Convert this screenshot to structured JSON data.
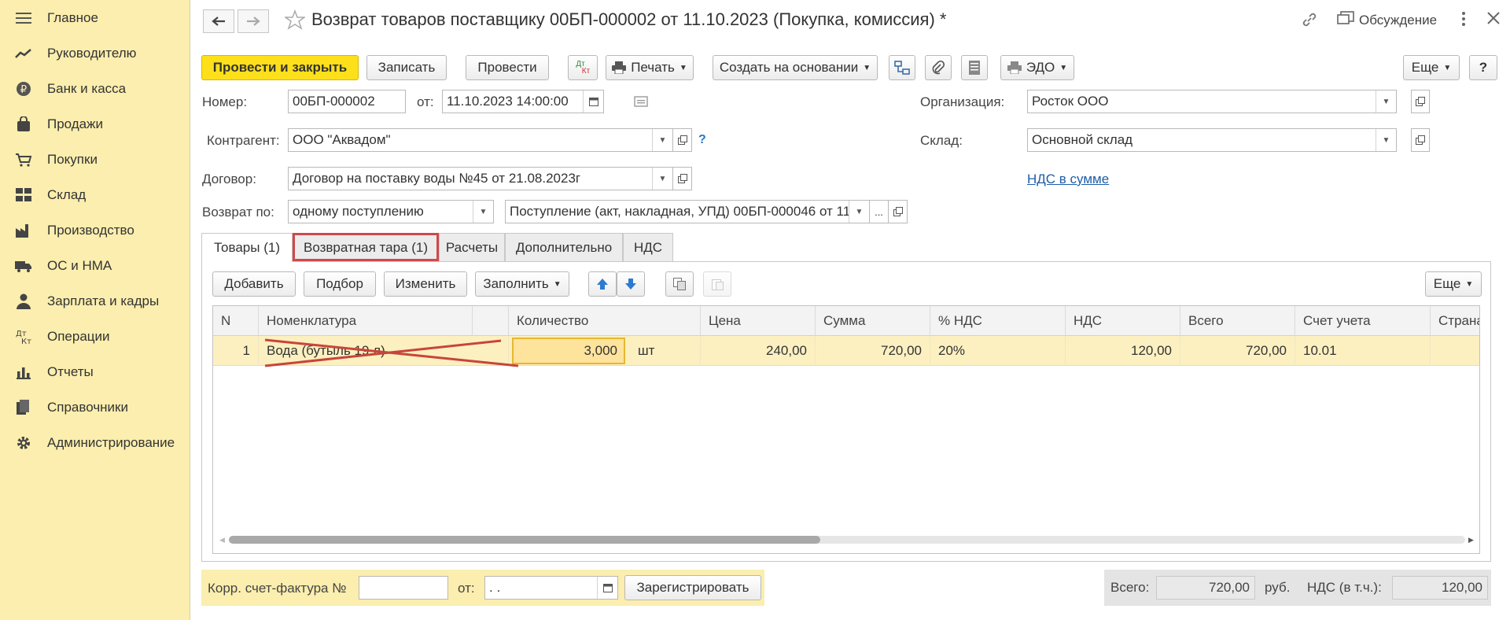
{
  "sidebar": {
    "items": [
      {
        "label": "Главное",
        "icon": "menu-icon"
      },
      {
        "label": "Руководителю",
        "icon": "trend-icon"
      },
      {
        "label": "Банк и касса",
        "icon": "ruble-icon"
      },
      {
        "label": "Продажи",
        "icon": "bag-icon"
      },
      {
        "label": "Покупки",
        "icon": "cart-icon"
      },
      {
        "label": "Склад",
        "icon": "warehouse-icon"
      },
      {
        "label": "Производство",
        "icon": "factory-icon"
      },
      {
        "label": "ОС и НМА",
        "icon": "truck-icon"
      },
      {
        "label": "Зарплата и кадры",
        "icon": "person-icon"
      },
      {
        "label": "Операции",
        "icon": "dt-kt-icon"
      },
      {
        "label": "Отчеты",
        "icon": "bar-chart-icon"
      },
      {
        "label": "Справочники",
        "icon": "books-icon"
      },
      {
        "label": "Администрирование",
        "icon": "gear-icon"
      }
    ]
  },
  "header": {
    "title": "Возврат товаров поставщику 00БП-000002 от 11.10.2023 (Покупка, комиссия) *",
    "discussion_label": "Обсуждение"
  },
  "toolbar": {
    "post_close": "Провести и закрыть",
    "save": "Записать",
    "post": "Провести",
    "dtkt_top": "Дт",
    "dtkt_bottom": "Кт",
    "print": "Печать",
    "create_based": "Создать на основании",
    "edo": "ЭДО",
    "more": "Еще",
    "help": "?"
  },
  "form": {
    "number_label": "Номер:",
    "number": "00БП-000002",
    "date_label": "от:",
    "date": "11.10.2023 14:00:00",
    "org_label": "Организация:",
    "org": "Росток ООО",
    "counterparty_label": "Контрагент:",
    "counterparty": "ООО \"Аквадом\"",
    "counterparty_help": "?",
    "warehouse_label": "Склад:",
    "warehouse": "Основной склад",
    "contract_label": "Договор:",
    "contract": "Договор на поставку воды №45 от 21.08.2023г",
    "vat_link": "НДС в сумме",
    "return_label": "Возврат по:",
    "return_by": "одному поступлению",
    "receipt": "Поступление (акт, накладная, УПД) 00БП-000046 от 11.",
    "ellipsis": "..."
  },
  "tabs": [
    {
      "label": "Товары (1)"
    },
    {
      "label": "Возвратная тара (1)"
    },
    {
      "label": "Расчеты"
    },
    {
      "label": "Дополнительно"
    },
    {
      "label": "НДС"
    }
  ],
  "table_toolbar": {
    "add": "Добавить",
    "pick": "Подбор",
    "edit": "Изменить",
    "fill": "Заполнить",
    "more": "Еще"
  },
  "table": {
    "headers": [
      "N",
      "Номенклатура",
      "",
      "Количество",
      "Цена",
      "Сумма",
      "% НДС",
      "НДС",
      "Всего",
      "Счет учета",
      "Страна"
    ],
    "rows": [
      {
        "n": "1",
        "item": "Вода (бутыль 19 л)",
        "qty": "3,000",
        "unit": "шт",
        "price": "240,00",
        "sum": "720,00",
        "vat_rate": "20%",
        "vat": "120,00",
        "total": "720,00",
        "account": "10.01"
      }
    ]
  },
  "footer": {
    "invoice_label": "Корр. счет-фактура №",
    "invoice_number": "",
    "from_label": "от:",
    "from_date": " .  .",
    "register": "Зарегистрировать",
    "total_label": "Всего:",
    "total": "720,00",
    "currency": "руб.",
    "vat_label": "НДС (в т.ч.):",
    "vat": "120,00"
  },
  "colors": {
    "accent": "#fde01a",
    "sidebar": "#fbeeae",
    "highlight": "#d0494b",
    "link": "#1f5ea8"
  }
}
